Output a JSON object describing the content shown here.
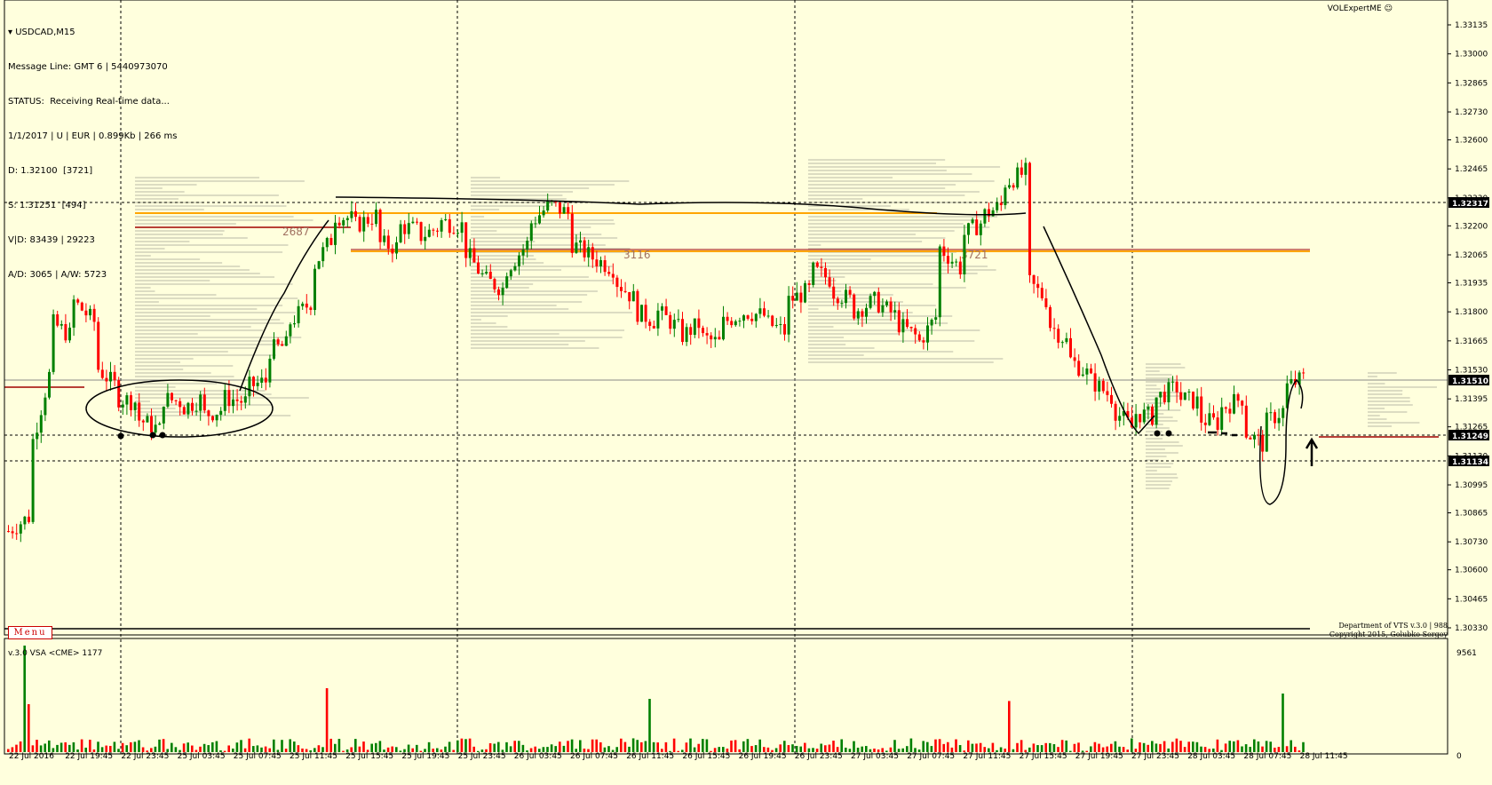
{
  "chart": {
    "symbol_label": "USDCAD,M15",
    "info_lines": [
      "Message Line: GMT 6 | 5440973070",
      "STATUS:  Receiving Real-time data...",
      "1/1/2017 | U | EUR | 0.899Kb | 266 ms",
      "D: 1.32100  [3721]",
      "S: 1.31251  [494]",
      "V|D: 83439 | 29223",
      "A/D: 3065 | A/W: 5723"
    ],
    "brand_label": "VOLExpertME",
    "menu_label": "Menu",
    "credits_line1": "Department of VTS  v.3.0 | 988",
    "credits_line2": "Copyright 2015, Golubko Sergey",
    "vsa_label": "v.3.0 VSA <CME> 1177",
    "volume_scale_max": "9561",
    "volume_scale_min": "0",
    "profile_labels": [
      "2687",
      "3116",
      "3721"
    ],
    "price_badges": [
      "1.32317",
      "1.31510",
      "1.31249",
      "1.31134"
    ],
    "colors": {
      "background": "#FFFFDD",
      "bull": "#008000",
      "bear": "#FF0000",
      "level_orange": "#FFA500",
      "level_darkred": "#A00000"
    }
  },
  "chart_data": {
    "type": "candlestick",
    "symbol": "USDCAD",
    "timeframe": "M15",
    "y_ticks": [
      "1.33135",
      "1.33000",
      "1.32865",
      "1.32730",
      "1.32600",
      "1.32465",
      "1.32330",
      "1.32200",
      "1.32065",
      "1.31935",
      "1.31800",
      "1.31665",
      "1.31530",
      "1.31395",
      "1.31265",
      "1.31130",
      "1.30995",
      "1.30865",
      "1.30730",
      "1.30600",
      "1.30465",
      "1.30330"
    ],
    "x_ticks": [
      "22 Jul 2016",
      "22 Jul 19:45",
      "22 Jul 23:45",
      "25 Jul 03:45",
      "25 Jul 07:45",
      "25 Jul 11:45",
      "25 Jul 15:45",
      "25 Jul 19:45",
      "25 Jul 23:45",
      "26 Jul 03:45",
      "26 Jul 07:45",
      "26 Jul 11:45",
      "26 Jul 15:45",
      "26 Jul 19:45",
      "26 Jul 23:45",
      "27 Jul 03:45",
      "27 Jul 07:45",
      "27 Jul 11:45",
      "27 Jul 15:45",
      "27 Jul 19:45",
      "27 Jul 23:45",
      "28 Jul 03:45",
      "28 Jul 07:45",
      "28 Jul 11:45"
    ],
    "ylim": [
      1.3033,
      1.332
    ],
    "path": [
      [
        1.3078,
        1.3085
      ],
      [
        1.3115,
        1.3155
      ],
      [
        1.3175,
        1.3168
      ],
      [
        1.3185,
        1.3175
      ],
      [
        1.3155,
        1.3145
      ],
      [
        1.314,
        1.3138
      ],
      [
        1.313,
        1.3125
      ],
      [
        1.314,
        1.3138
      ],
      [
        1.3135,
        1.314
      ],
      [
        1.3132,
        1.3135
      ],
      [
        1.314,
        1.3138
      ],
      [
        1.3145,
        1.3148
      ],
      [
        1.3162,
        1.3165
      ],
      [
        1.3175,
        1.3185
      ],
      [
        1.32,
        1.3215
      ],
      [
        1.3225,
        1.3223
      ],
      [
        1.322,
        1.3225
      ],
      [
        1.3212,
        1.321
      ],
      [
        1.322,
        1.3218
      ],
      [
        1.3215,
        1.322
      ],
      [
        1.3222,
        1.322
      ],
      [
        1.321,
        1.3195
      ],
      [
        1.3195,
        1.319
      ],
      [
        1.32,
        1.3212
      ],
      [
        1.322,
        1.323
      ],
      [
        1.323,
        1.3225
      ],
      [
        1.3212,
        1.3205
      ],
      [
        1.3205,
        1.32
      ],
      [
        1.3195,
        1.3185
      ],
      [
        1.318,
        1.3175
      ],
      [
        1.318,
        1.3172
      ],
      [
        1.3168,
        1.3175
      ],
      [
        1.3168,
        1.3165
      ],
      [
        1.3175,
        1.318
      ],
      [
        1.318,
        1.3178
      ],
      [
        1.3175,
        1.317
      ],
      [
        1.3185,
        1.319
      ],
      [
        1.32,
        1.3195
      ],
      [
        1.319,
        1.3185
      ],
      [
        1.318,
        1.3185
      ],
      [
        1.3185,
        1.3178
      ],
      [
        1.3175,
        1.3168
      ],
      [
        1.3165,
        1.318
      ],
      [
        1.321,
        1.32
      ],
      [
        1.3215,
        1.3222
      ],
      [
        1.3225,
        1.323
      ],
      [
        1.324,
        1.3245
      ],
      [
        1.3195,
        1.3185
      ],
      [
        1.3175,
        1.3165
      ],
      [
        1.3158,
        1.315
      ],
      [
        1.3148,
        1.314
      ],
      [
        1.3135,
        1.3125
      ],
      [
        1.3133,
        1.3131
      ],
      [
        1.314,
        1.3145
      ],
      [
        1.314,
        1.3138
      ],
      [
        1.313,
        1.3128
      ],
      [
        1.3135,
        1.314
      ],
      [
        1.3125,
        1.3118
      ],
      [
        1.3128,
        1.3135
      ],
      [
        1.3145,
        1.315
      ]
    ],
    "volume_profile_levels": [
      {
        "label": "2687",
        "price": 1.321
      },
      {
        "label": "3116",
        "price": 1.321
      },
      {
        "label": "3721",
        "price": 1.321
      }
    ],
    "horizontal_levels": [
      1.32317,
      1.3151,
      1.31249,
      1.31134
    ]
  }
}
